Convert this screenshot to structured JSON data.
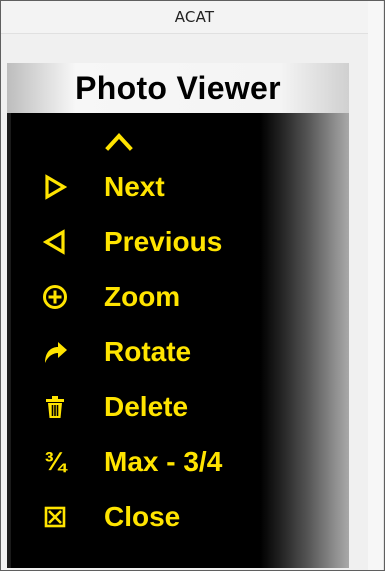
{
  "window": {
    "title": "ACAT"
  },
  "panel": {
    "title": "Photo Viewer"
  },
  "menu": {
    "items": [
      {
        "label": "Next",
        "icon": "triangle-right-icon"
      },
      {
        "label": "Previous",
        "icon": "triangle-left-icon"
      },
      {
        "label": "Zoom",
        "icon": "zoom-plus-icon"
      },
      {
        "label": "Rotate",
        "icon": "rotate-arrow-icon"
      },
      {
        "label": "Delete",
        "icon": "trash-icon"
      },
      {
        "label": "Max - 3/4",
        "icon": "three-quarters-icon",
        "glyph": "¾"
      },
      {
        "label": "Close",
        "icon": "close-box-icon",
        "glyph": "⊠"
      }
    ]
  },
  "colors": {
    "accent": "#ffe400",
    "panel_bg": "#000000",
    "title_bg": "#f4f4f4"
  }
}
